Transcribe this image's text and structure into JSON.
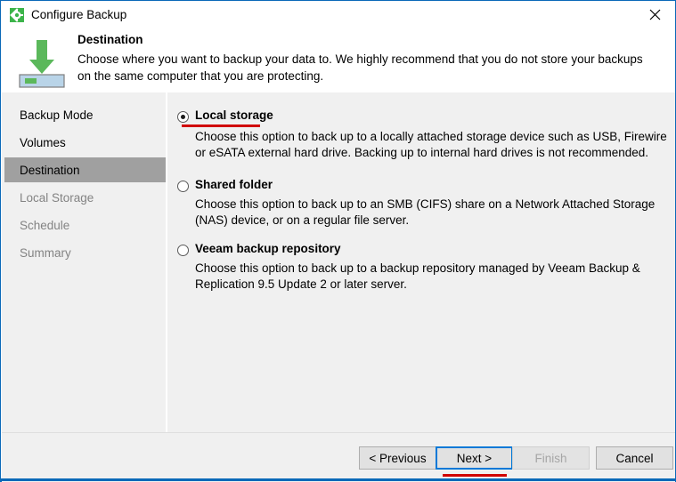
{
  "window": {
    "title": "Configure Backup",
    "title_icon": "gear-icon",
    "close_icon": "close-icon",
    "accent_color": "#0a69b8"
  },
  "header": {
    "icon": "download-to-disk-icon",
    "title": "Destination",
    "description": "Choose where you want to backup your data to. We highly recommend that you do not store your backups on the same computer that you are protecting."
  },
  "sidebar": {
    "items": [
      {
        "label": "Backup Mode",
        "state": "done"
      },
      {
        "label": "Volumes",
        "state": "done"
      },
      {
        "label": "Destination",
        "state": "active"
      },
      {
        "label": "Local Storage",
        "state": "future"
      },
      {
        "label": "Schedule",
        "state": "future"
      },
      {
        "label": "Summary",
        "state": "future"
      }
    ]
  },
  "options": {
    "selected": "local_storage",
    "items": [
      {
        "id": "local_storage",
        "label": "Local storage",
        "description": "Choose this option to back up to a locally attached storage device such as USB, Firewire or eSATA external hard drive. Backing up to internal hard drives is not recommended.",
        "checked": true,
        "highlighted": true
      },
      {
        "id": "shared_folder",
        "label": "Shared folder",
        "description": "Choose this option to back up to an SMB (CIFS) share on a Network Attached Storage (NAS) device, or on a regular file server.",
        "checked": false,
        "highlighted": false
      },
      {
        "id": "veeam_backup_repository",
        "label": "Veeam backup repository",
        "description": "Choose this option to back up to a backup repository managed by Veeam Backup & Replication 9.5 Update 2 or later server.",
        "checked": false,
        "highlighted": false
      }
    ]
  },
  "footer": {
    "previous_label": "< Previous",
    "next_label": "Next >",
    "finish_label": "Finish",
    "cancel_label": "Cancel",
    "next_focused": true,
    "finish_disabled": true,
    "highlight_color": "#d00000"
  }
}
